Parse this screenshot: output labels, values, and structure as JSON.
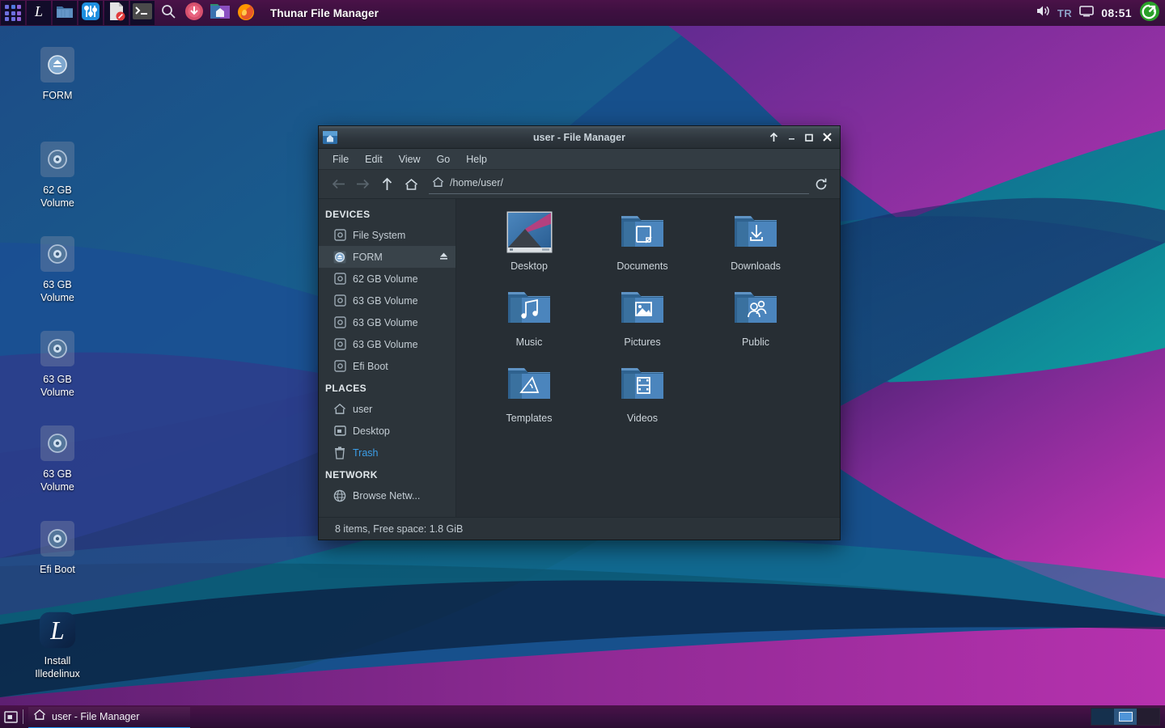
{
  "panel": {
    "title": "Thunar File Manager",
    "launchers": [
      {
        "name": "app-grid-launcher",
        "label": "Applications"
      },
      {
        "name": "illedelinux-launcher",
        "label": "Illedelinux"
      },
      {
        "name": "file-manager-launcher",
        "label": "File Manager"
      },
      {
        "name": "settings-manager-launcher",
        "label": "Settings"
      },
      {
        "name": "text-editor-launcher",
        "label": "Text Editor"
      },
      {
        "name": "terminal-launcher",
        "label": "Terminal"
      },
      {
        "name": "search-launcher",
        "label": "Search"
      },
      {
        "name": "update-launcher",
        "label": "Updates"
      },
      {
        "name": "home-folder-launcher",
        "label": "Home"
      },
      {
        "name": "firefox-launcher",
        "label": "Firefox"
      }
    ],
    "tray": {
      "volume_icon": "speaker-icon",
      "keyboard_layout": "TR",
      "display_icon": "display-icon",
      "clock": "08:51",
      "logout_icon": "logout-icon"
    }
  },
  "desktop_icons": [
    {
      "name": "desktop-icon-form",
      "label": "FORM",
      "icon": "optical-disc-eject-icon"
    },
    {
      "name": "desktop-icon-62gb",
      "label": "62 GB\nVolume",
      "icon": "drive-icon"
    },
    {
      "name": "desktop-icon-63gb-1",
      "label": "63 GB\nVolume",
      "icon": "drive-icon"
    },
    {
      "name": "desktop-icon-63gb-2",
      "label": "63 GB\nVolume",
      "icon": "drive-icon"
    },
    {
      "name": "desktop-icon-63gb-3",
      "label": "63 GB\nVolume",
      "icon": "drive-icon"
    },
    {
      "name": "desktop-icon-efi-boot",
      "label": "Efi Boot",
      "icon": "drive-icon"
    },
    {
      "name": "desktop-icon-installer",
      "label": "Install\nIlledelinux",
      "icon": "illedelinux-icon"
    }
  ],
  "window": {
    "title": "user - File Manager",
    "titlebar_buttons": {
      "shade": "▲",
      "minimize": "–",
      "maximize": "❐",
      "close": "✕"
    },
    "menu": [
      "File",
      "Edit",
      "View",
      "Go",
      "Help"
    ],
    "toolbar": {
      "back_icon": "arrow-left-icon",
      "forward_icon": "arrow-right-icon",
      "up_icon": "arrow-up-icon",
      "home_icon": "home-icon",
      "reload_icon": "reload-icon"
    },
    "path": {
      "icon": "home-icon",
      "value": "/home/user/"
    },
    "sidebar": {
      "devices_header": "DEVICES",
      "devices": [
        {
          "label": "File System",
          "icon": "drive-icon",
          "selected": false,
          "eject": false
        },
        {
          "label": "FORM",
          "icon": "optical-disc-icon",
          "selected": true,
          "eject": true
        },
        {
          "label": "62 GB Volume",
          "icon": "drive-icon",
          "selected": false,
          "eject": false
        },
        {
          "label": "63 GB Volume",
          "icon": "drive-icon",
          "selected": false,
          "eject": false
        },
        {
          "label": "63 GB Volume",
          "icon": "drive-icon",
          "selected": false,
          "eject": false
        },
        {
          "label": "63 GB Volume",
          "icon": "drive-icon",
          "selected": false,
          "eject": false
        },
        {
          "label": "Efi Boot",
          "icon": "drive-icon",
          "selected": false,
          "eject": false
        }
      ],
      "places_header": "PLACES",
      "places": [
        {
          "label": "user",
          "icon": "home-icon",
          "trash": false
        },
        {
          "label": "Desktop",
          "icon": "desktop-icon",
          "trash": false
        },
        {
          "label": "Trash",
          "icon": "trash-icon",
          "trash": true
        }
      ],
      "network_header": "NETWORK",
      "network": [
        {
          "label": "Browse Netw...",
          "icon": "globe-icon"
        }
      ]
    },
    "files": [
      {
        "name": "Desktop",
        "icon": "desktop-wallpaper-thumbnail"
      },
      {
        "name": "Documents",
        "icon": "folder-documents-icon"
      },
      {
        "name": "Downloads",
        "icon": "folder-downloads-icon"
      },
      {
        "name": "Music",
        "icon": "folder-music-icon"
      },
      {
        "name": "Pictures",
        "icon": "folder-pictures-icon"
      },
      {
        "name": "Public",
        "icon": "folder-public-icon"
      },
      {
        "name": "Templates",
        "icon": "folder-templates-icon"
      },
      {
        "name": "Videos",
        "icon": "folder-videos-icon"
      }
    ],
    "statusbar": "8 items, Free space: 1.8 GiB"
  },
  "taskbar": {
    "show_desktop_icon": "show-desktop-icon",
    "task": {
      "label": "user - File Manager",
      "icon": "home-icon"
    },
    "workspaces": 3,
    "active_workspace": 2
  },
  "colors": {
    "panel_bg": "#3d1040",
    "accent_blue": "#2196f3",
    "trash_link": "#3b9ee8",
    "window_bg": "#272e34",
    "sidebar_bg": "#2c343a",
    "folder_blue": "#4a7fb5"
  }
}
